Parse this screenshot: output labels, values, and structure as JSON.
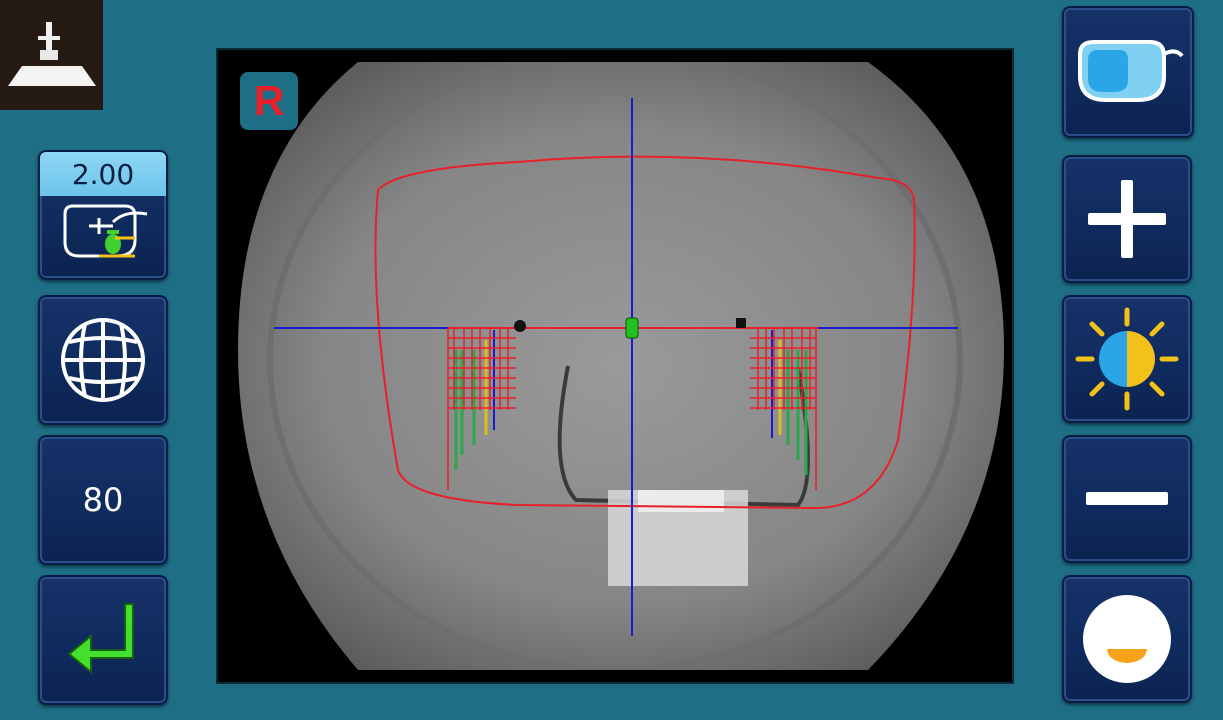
{
  "viewer": {
    "eye_label": "R"
  },
  "left_panel": {
    "addition_value": "2.00",
    "number_button_label": "80"
  },
  "icons": {
    "logo": "lensmeter-logo",
    "addition": "progressive-lens-add-icon",
    "grid": "globe-grid-icon",
    "enter": "enter-return-icon",
    "glasses": "spectacle-lens-icon",
    "plus": "plus-icon",
    "brightness": "brightness-sun-icon",
    "minus": "minus-icon",
    "level": "half-circle-level-icon"
  },
  "colors": {
    "background": "#1e6e86",
    "button": "#12306a",
    "value_bar": "#7ccdf0",
    "frame_outline": "#e8202a",
    "crosshair": "#1a1ad0",
    "enter_arrow": "#44e02e",
    "sun": "#f2c21a",
    "sun_core_left": "#2aa6e6",
    "level_fill": "#f5a21a"
  }
}
